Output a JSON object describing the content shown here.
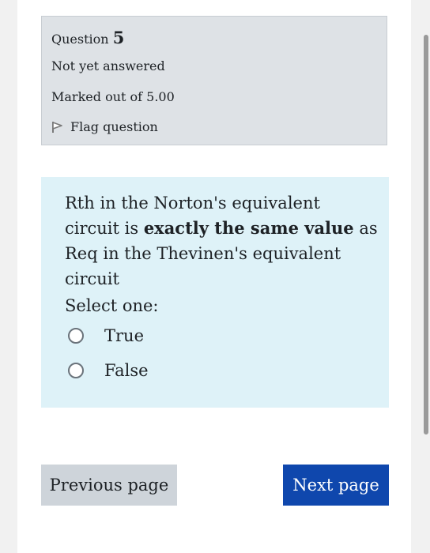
{
  "question_info": {
    "question_word": "Question",
    "question_number": "5",
    "status": "Not yet answered",
    "marked_out_of": "Marked out of 5.00",
    "flag_label": "Flag question"
  },
  "question": {
    "text_before": "Rth in the Norton's equivalent circuit is ",
    "text_bold": "exactly the same value",
    "text_after": " as Req in the Thevinen's equivalent circuit",
    "select_prompt": "Select one:",
    "options": [
      {
        "label": "True",
        "selected": false
      },
      {
        "label": "False",
        "selected": false
      }
    ]
  },
  "navigation": {
    "previous_label": "Previous page",
    "next_label": "Next page"
  },
  "colors": {
    "info_background": "#dee2e6",
    "content_background": "#def2f8",
    "next_button": "#0f47ad",
    "previous_button": "#ced4da"
  },
  "icons": {
    "flag": "flag-icon",
    "radio": "radio-button"
  }
}
